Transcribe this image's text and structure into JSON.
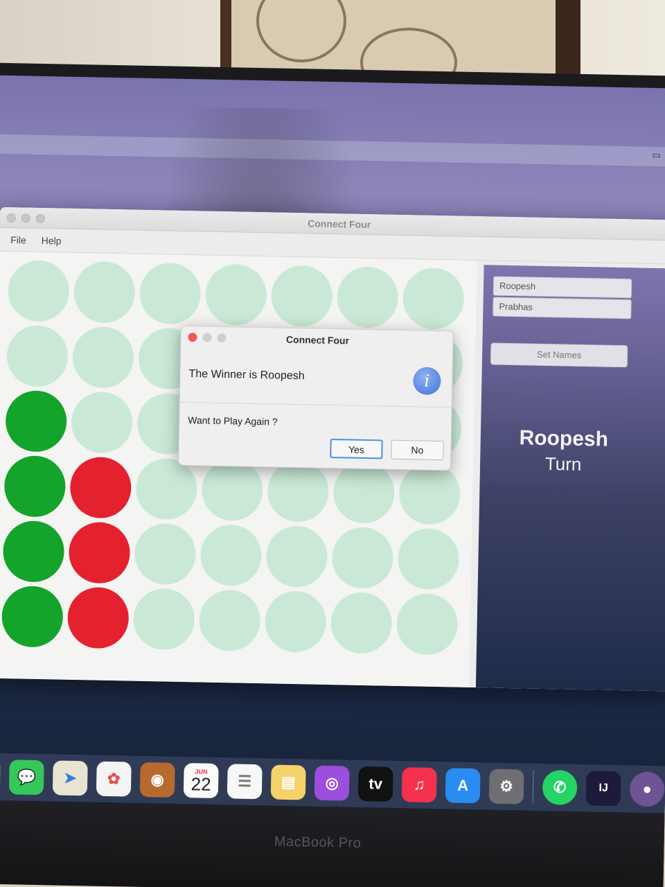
{
  "app": {
    "window_title": "Connect Four",
    "menu": [
      "File",
      "Help"
    ]
  },
  "board": {
    "columns": 7,
    "rows": 6,
    "cells": [
      [
        "empty",
        "empty",
        "empty",
        "empty",
        "empty",
        "empty",
        "empty"
      ],
      [
        "empty",
        "empty",
        "empty",
        "empty",
        "empty",
        "empty",
        "empty"
      ],
      [
        "green",
        "empty",
        "empty",
        "empty",
        "empty",
        "empty",
        "empty"
      ],
      [
        "green",
        "red",
        "empty",
        "empty",
        "empty",
        "empty",
        "empty"
      ],
      [
        "green",
        "red",
        "empty",
        "empty",
        "empty",
        "empty",
        "empty"
      ],
      [
        "green",
        "red",
        "empty",
        "empty",
        "empty",
        "empty",
        "empty"
      ]
    ],
    "colors": {
      "green": "#14a32b",
      "red": "#e4212f",
      "empty": "#c9e9d6"
    }
  },
  "side_panel": {
    "player1": "Roopesh",
    "player2": "Prabhas",
    "set_names_label": "Set Names",
    "turn_name": "Roopesh",
    "turn_label": "Turn"
  },
  "dialog": {
    "title": "Connect Four",
    "message": "The Winner is Roopesh",
    "question": "Want to Play Again ?",
    "yes_label": "Yes",
    "no_label": "No",
    "icon": "info-icon"
  },
  "dock": {
    "calendar_month": "JUN",
    "calendar_day": "22",
    "tv_label": "tv",
    "intellij_label": "IJ"
  },
  "device": {
    "label": "MacBook Pro"
  }
}
